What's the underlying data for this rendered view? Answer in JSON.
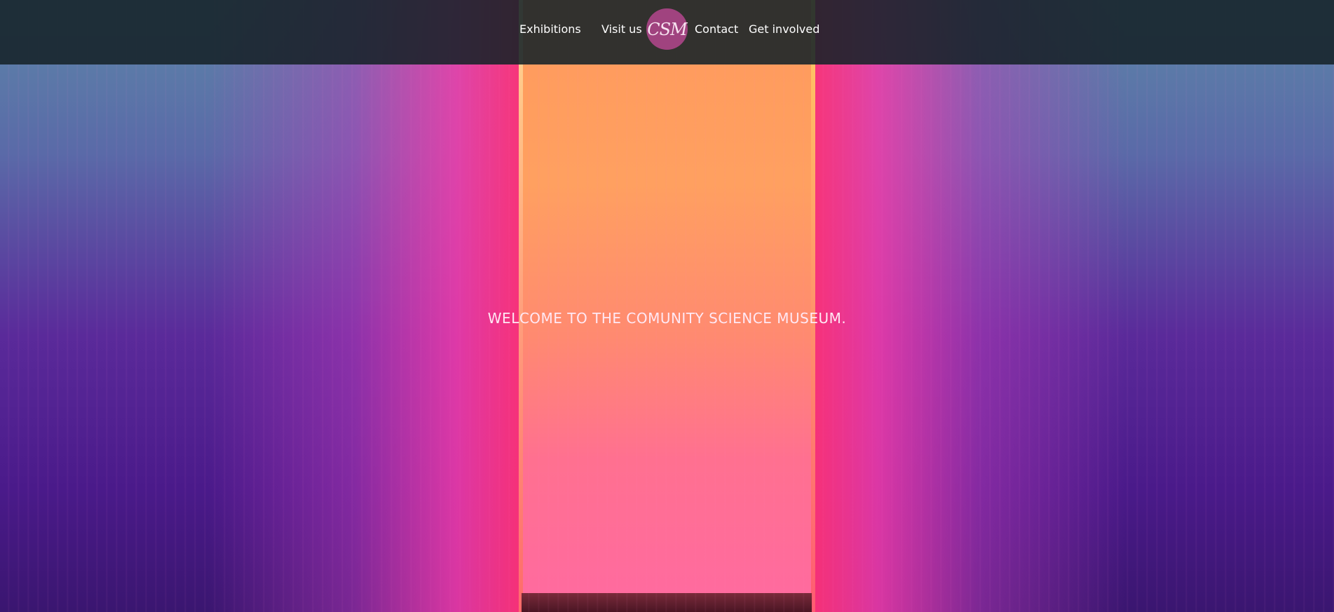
{
  "nav": {
    "items": [
      {
        "label": "Exhibitions"
      },
      {
        "label": "Visit us"
      },
      {
        "label": "Contact"
      },
      {
        "label": "Get involved"
      }
    ],
    "logo_text": "CSM",
    "logo_color": "#a0437f",
    "bar_color": "#162228"
  },
  "hero": {
    "welcome_text": "WELCOME TO THE COMUNITY SCIENCE MUSEUM."
  }
}
